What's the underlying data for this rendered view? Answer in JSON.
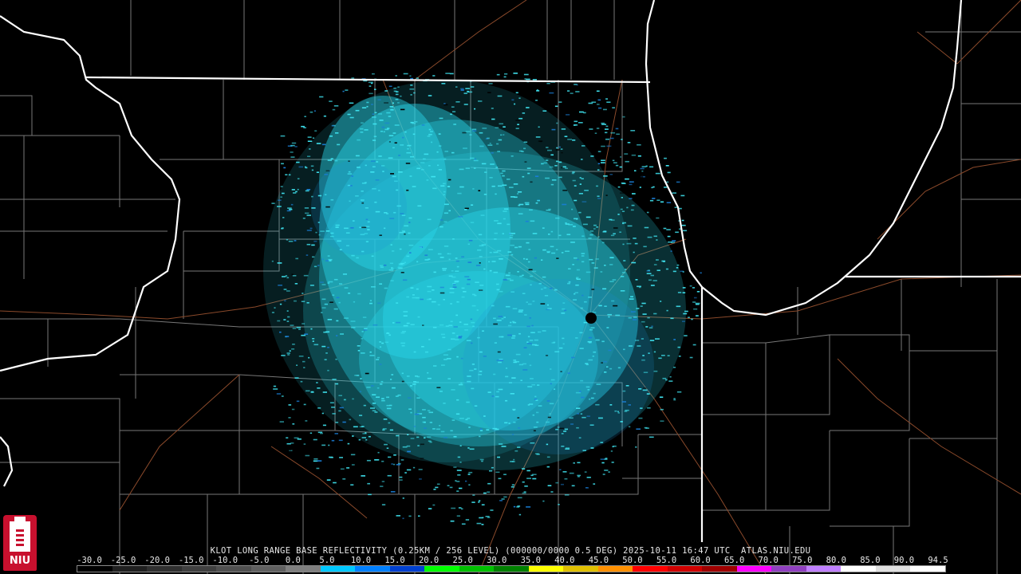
{
  "caption": "KLOT LONG RANGE BASE REFLECTIVITY (0.25KM / 256 LEVEL) (000000/0000 0.5 DEG) 2025-10-11 16:47 UTC  ATLAS.NIU.EDU",
  "scale": {
    "ticks": [
      "-30.0",
      "-25.0",
      "-20.0",
      "-15.0",
      "-10.0",
      "-5.0",
      "0.0",
      "5.0",
      "10.0",
      "15.0",
      "20.0",
      "25.0",
      "30.0",
      "35.0",
      "40.0",
      "45.0",
      "50.0",
      "55.0",
      "60.0",
      "65.0",
      "70.0",
      "75.0",
      "80.0",
      "85.0",
      "90.0",
      "94.5"
    ],
    "colors": [
      "#000000",
      "#202020",
      "#303030",
      "#404040",
      "#505050",
      "#606060",
      "#7f7f7f",
      "#00c8ff",
      "#0080ff",
      "#0040d0",
      "#00ff00",
      "#00c000",
      "#008000",
      "#ffff00",
      "#e0c000",
      "#ff9000",
      "#ff0000",
      "#d00000",
      "#a00000",
      "#ff00ff",
      "#9040c0",
      "#c080ff",
      "#ffffff",
      "#e0e0e0",
      "#ffffff"
    ]
  },
  "logo": {
    "text": "NIU",
    "colors": {
      "red": "#c8102e",
      "white": "#ffffff"
    }
  },
  "map_colors": {
    "state_borders": "#ffffff",
    "county_lines": "#7a7a7a",
    "roads": "#8b4a2b",
    "echo_main": "#29d5e8",
    "echo_dark": "#1a8fd8",
    "radar_site": "#000000"
  }
}
